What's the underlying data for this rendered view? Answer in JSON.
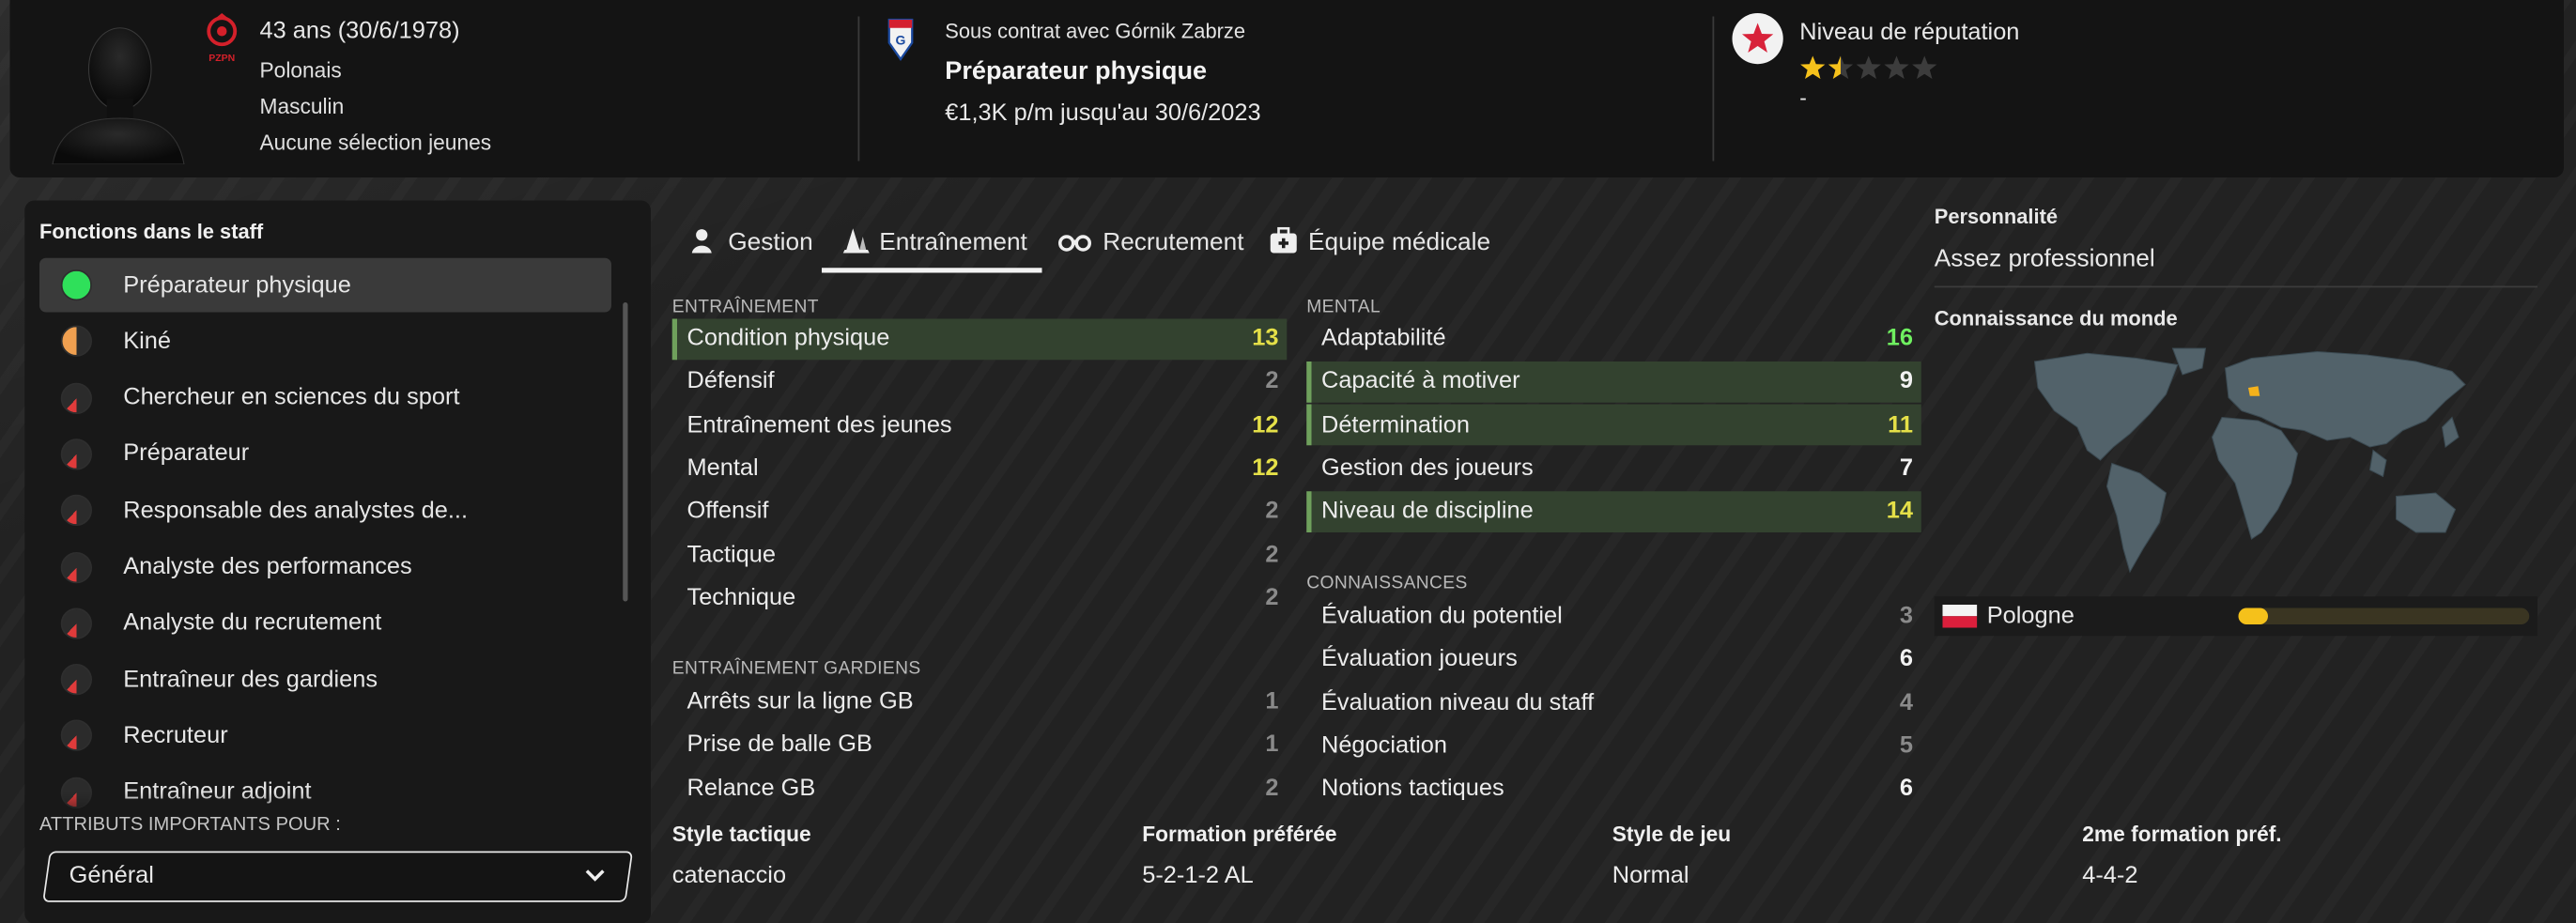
{
  "header": {
    "age": "43 ans (30/6/1978)",
    "nationality": "Polonais",
    "gender": "Masculin",
    "youth_caps": "Aucune sélection jeunes",
    "contract_club": "Sous contrat avec Górnik Zabrze",
    "job": "Préparateur physique",
    "salary": "€1,3K p/m jusqu'au 30/6/2023",
    "reputation_label": "Niveau de réputation",
    "reputation_stars": 1.5,
    "reputation_max": 5,
    "reputation_sub": "-"
  },
  "roles_panel": {
    "title": "Fonctions dans le staff",
    "items": [
      {
        "label": "Préparateur physique",
        "color": "#2fe05a",
        "fill": 1.0
      },
      {
        "label": "Kiné",
        "color": "#f0a050",
        "fill": 0.5
      },
      {
        "label": "Chercheur en sciences du sport",
        "color": "#e03b3b",
        "fill": 0.12
      },
      {
        "label": "Préparateur",
        "color": "#e03b3b",
        "fill": 0.12
      },
      {
        "label": "Responsable des analystes de...",
        "color": "#e03b3b",
        "fill": 0.12
      },
      {
        "label": "Analyste des performances",
        "color": "#e03b3b",
        "fill": 0.12
      },
      {
        "label": "Analyste du recrutement",
        "color": "#e03b3b",
        "fill": 0.12
      },
      {
        "label": "Entraîneur des gardiens",
        "color": "#e03b3b",
        "fill": 0.12
      },
      {
        "label": "Recruteur",
        "color": "#e03b3b",
        "fill": 0.12
      },
      {
        "label": "Entraîneur adjoint",
        "color": "#e03b3b",
        "fill": 0.12
      }
    ],
    "important_label": "ATTRIBUTS IMPORTANTS POUR :",
    "dropdown_value": "Général"
  },
  "tabs": [
    {
      "label": "Gestion",
      "icon": "person-icon"
    },
    {
      "label": "Entraînement",
      "icon": "cones-icon",
      "active": true
    },
    {
      "label": "Recrutement",
      "icon": "binoculars-icon"
    },
    {
      "label": "Équipe médicale",
      "icon": "medical-kit-icon"
    }
  ],
  "sections": {
    "training": {
      "title": "ENTRAÎNEMENT",
      "rows": [
        {
          "name": "Condition physique",
          "value": "13",
          "hl": true,
          "tone": "y"
        },
        {
          "name": "Défensif",
          "value": "2",
          "tone": "g"
        },
        {
          "name": "Entraînement des jeunes",
          "value": "12",
          "tone": "y"
        },
        {
          "name": "Mental",
          "value": "12",
          "tone": "y"
        },
        {
          "name": "Offensif",
          "value": "2",
          "tone": "g"
        },
        {
          "name": "Tactique",
          "value": "2",
          "tone": "g"
        },
        {
          "name": "Technique",
          "value": "2",
          "tone": "g"
        }
      ]
    },
    "goalkeeping": {
      "title": "ENTRAÎNEMENT GARDIENS",
      "rows": [
        {
          "name": "Arrêts sur la ligne GB",
          "value": "1",
          "tone": "g"
        },
        {
          "name": "Prise de balle GB",
          "value": "1",
          "tone": "g"
        },
        {
          "name": "Relance GB",
          "value": "2",
          "tone": "g"
        }
      ]
    },
    "mental": {
      "title": "MENTAL",
      "rows": [
        {
          "name": "Adaptabilité",
          "value": "16",
          "tone": "gr"
        },
        {
          "name": "Capacité à motiver",
          "value": "9",
          "hl": true,
          "tone": "w"
        },
        {
          "name": "Détermination",
          "value": "11",
          "hl": true,
          "tone": "y"
        },
        {
          "name": "Gestion des joueurs",
          "value": "7",
          "tone": "w"
        },
        {
          "name": "Niveau de discipline",
          "value": "14",
          "hl": true,
          "tone": "y"
        }
      ]
    },
    "knowledge": {
      "title": "CONNAISSANCES",
      "rows": [
        {
          "name": "Évaluation du potentiel",
          "value": "3",
          "tone": "g"
        },
        {
          "name": "Évaluation joueurs",
          "value": "6",
          "tone": "w"
        },
        {
          "name": "Évaluation niveau du staff",
          "value": "4",
          "tone": "g"
        },
        {
          "name": "Négociation",
          "value": "5",
          "tone": "g"
        },
        {
          "name": "Notions tactiques",
          "value": "6",
          "tone": "w"
        }
      ]
    }
  },
  "bottom": [
    {
      "label": "Style tactique",
      "value": "catenaccio"
    },
    {
      "label": "Formation préférée",
      "value": "5-2-1-2 AL"
    },
    {
      "label": "Style de jeu",
      "value": "Normal"
    },
    {
      "label": "2me formation préf.",
      "value": "4-4-2"
    }
  ],
  "right": {
    "personality_label": "Personnalité",
    "personality_value": "Assez professionnel",
    "world_label": "Connaissance du monde",
    "country": "Pologne",
    "country_knowledge": 0.05
  }
}
